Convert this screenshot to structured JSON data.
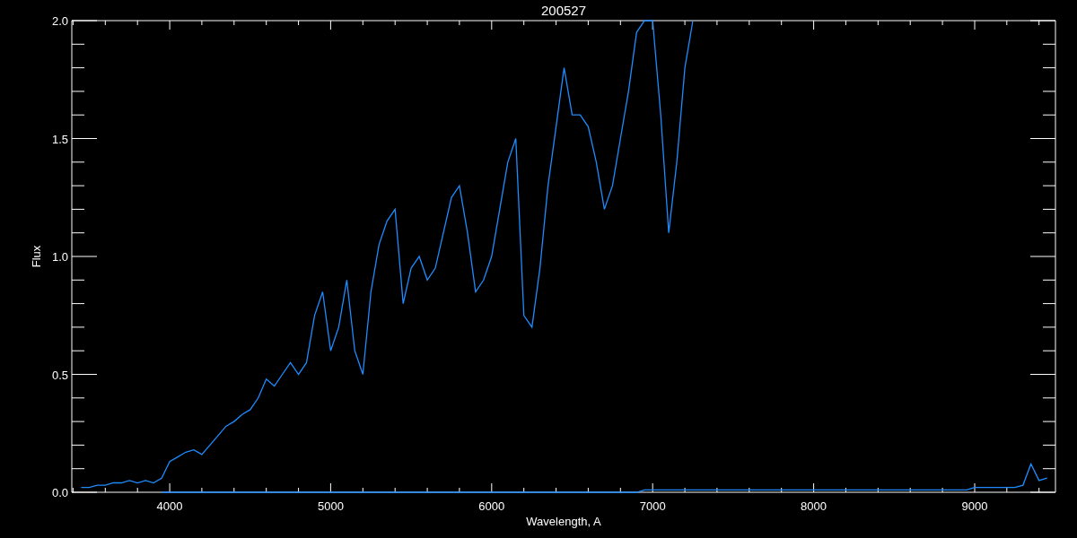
{
  "chart_data": {
    "type": "line",
    "title": "200527",
    "xlabel": "Wavelength, A",
    "ylabel": "Flux",
    "xlim": [
      3392,
      9502
    ],
    "ylim": [
      0,
      2
    ],
    "xticks": [
      4000,
      5000,
      6000,
      7000,
      8000,
      9000
    ],
    "yticks": [
      {
        "value": 0,
        "label": "0.0"
      },
      {
        "value": 0.5,
        "label": "0.5"
      },
      {
        "value": 1,
        "label": "1.0"
      },
      {
        "value": 1.5,
        "label": "1.5"
      },
      {
        "value": 2,
        "label": "2.0"
      }
    ],
    "x": [
      3450,
      3500,
      3550,
      3600,
      3650,
      3700,
      3750,
      3800,
      3850,
      3900,
      3950,
      4000,
      4050,
      4100,
      4150,
      4200,
      4250,
      4300,
      4350,
      4400,
      4450,
      4500,
      4550,
      4600,
      4650,
      4700,
      4750,
      4800,
      4850,
      4900,
      4950,
      5000,
      5050,
      5100,
      5150,
      5200,
      5250,
      5300,
      5350,
      5400,
      5450,
      5500,
      5550,
      5600,
      5650,
      5700,
      5750,
      5800,
      5850,
      5900,
      5950,
      6000,
      6050,
      6100,
      6150,
      6200,
      6250,
      6300,
      6350,
      6400,
      6450,
      6500,
      6550,
      6600,
      6650,
      6700,
      6750,
      6800,
      6850,
      6900,
      6950,
      7000,
      7050,
      7100,
      7150,
      7200,
      7250,
      7300,
      7350,
      7400,
      7450,
      7500,
      7550,
      7600,
      7650,
      7700,
      7750,
      7800,
      7850,
      7900,
      7950,
      8000,
      8050,
      8100,
      8150,
      8200,
      8250,
      8300,
      8350,
      8400,
      8450,
      8500,
      8550,
      8600,
      8650,
      8700,
      8750,
      8800,
      8850,
      8900,
      8950,
      9000,
      9050,
      9100,
      9150,
      9200,
      9250,
      9300,
      9350,
      9400,
      9450
    ],
    "series": [
      {
        "color": "#1e8cff",
        "values": [
          0.02,
          0.02,
          0.03,
          0.03,
          0.04,
          0.04,
          0.05,
          0.04,
          0.05,
          0.04,
          0.06,
          0.13,
          0.15,
          0.17,
          0.18,
          0.16,
          0.2,
          0.24,
          0.28,
          0.3,
          0.33,
          0.35,
          0.4,
          0.48,
          0.45,
          0.5,
          0.55,
          0.5,
          0.55,
          0.75,
          0.85,
          0.6,
          0.7,
          0.9,
          0.6,
          0.5,
          0.85,
          1.05,
          1.15,
          1.2,
          0.8,
          0.95,
          1.0,
          0.9,
          0.95,
          1.1,
          1.25,
          1.3,
          1.1,
          0.85,
          0.9,
          1.0,
          1.2,
          1.4,
          1.5,
          0.75,
          0.7,
          0.95,
          1.3,
          1.55,
          1.8,
          1.6,
          1.6,
          1.55,
          1.4,
          1.2,
          1.3,
          1.5,
          1.7,
          1.95,
          2.0,
          2.0,
          1.6,
          1.1,
          1.4,
          1.8,
          2.0,
          null,
          null,
          null,
          null,
          null,
          null,
          null,
          null,
          null,
          null,
          null,
          null,
          null,
          null,
          null,
          null,
          null,
          null,
          null,
          null,
          null,
          null,
          null,
          null,
          null,
          null,
          null,
          null,
          null,
          null,
          null,
          null,
          null,
          null,
          null,
          null,
          null,
          null,
          null,
          null,
          null,
          null,
          null,
          null
        ]
      },
      {
        "color": "#1e8cff",
        "values": [
          null,
          null,
          null,
          null,
          null,
          null,
          null,
          null,
          null,
          null,
          0.0,
          0.0,
          0.0,
          0.0,
          0.0,
          0.0,
          0.0,
          0.0,
          0.0,
          0.0,
          0.0,
          0.0,
          0.0,
          0.0,
          0.0,
          0.0,
          0.0,
          0.0,
          0.0,
          0.0,
          0.0,
          0.0,
          0.0,
          0.0,
          0.0,
          0.0,
          0.0,
          0.0,
          0.0,
          0.0,
          0.0,
          0.0,
          0.0,
          0.0,
          0.0,
          0.0,
          0.0,
          0.0,
          0.0,
          0.0,
          0.0,
          0.0,
          0.0,
          0.0,
          0.0,
          0.0,
          0.0,
          0.0,
          0.0,
          0.0,
          0.0,
          0.0,
          0.0,
          0.0,
          0.0,
          0.0,
          0.0,
          0.0,
          0.0,
          0.0,
          0.01,
          0.01,
          0.01,
          0.01,
          0.01,
          0.01,
          0.01,
          0.01,
          0.01,
          0.01,
          0.01,
          0.01,
          0.01,
          0.01,
          0.01,
          0.01,
          0.01,
          0.01,
          0.01,
          0.01,
          0.01,
          0.01,
          0.01,
          0.01,
          0.01,
          0.01,
          0.01,
          0.01,
          0.01,
          0.01,
          0.01,
          0.01,
          0.01,
          0.01,
          0.01,
          0.01,
          0.01,
          0.01,
          0.01,
          0.01,
          0.01,
          0.02,
          0.02,
          0.02,
          0.02,
          0.02,
          0.02,
          0.03,
          0.12,
          0.05,
          0.06
        ]
      }
    ]
  }
}
